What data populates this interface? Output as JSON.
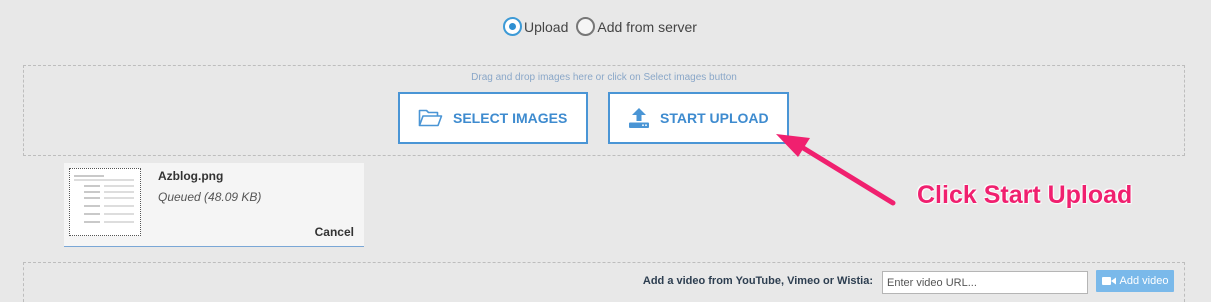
{
  "source_toggle": {
    "upload_label": "Upload",
    "server_label": "Add from server",
    "selected": "upload"
  },
  "dropzone": {
    "hint": "Drag and drop images here or click on Select images button",
    "select_label": "SELECT IMAGES",
    "upload_label": "START UPLOAD",
    "select_icon": "folder-open-icon",
    "upload_icon": "upload-icon"
  },
  "file": {
    "name": "Azblog.png",
    "status": "Queued (48.09 KB)",
    "cancel_label": "Cancel"
  },
  "annotation": {
    "text": "Click Start Upload",
    "color": "#f0206f"
  },
  "video": {
    "label": "Add a video from YouTube, Vimeo or Wistia:",
    "placeholder": "Enter video URL...",
    "button_label": "Add video",
    "button_icon": "video-camera-icon"
  },
  "colors": {
    "accent": "#3e8bcf",
    "radio_selected": "#2e8fd2",
    "add_video_bg": "#7ab9ea"
  }
}
